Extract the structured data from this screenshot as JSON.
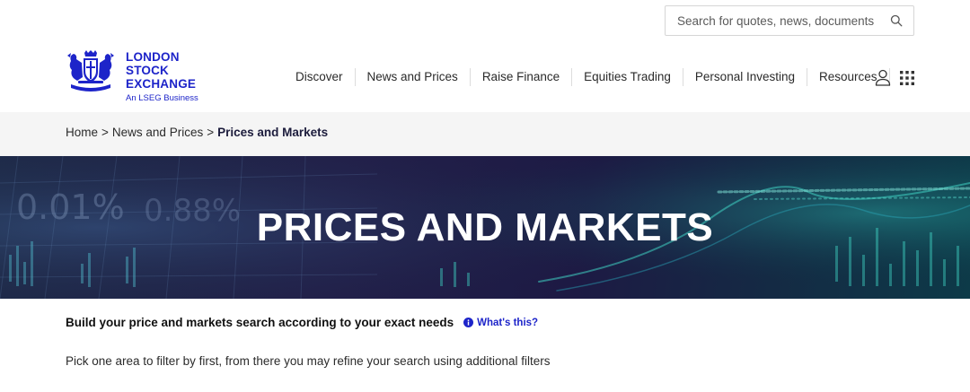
{
  "search": {
    "placeholder": "Search for quotes, news, documents",
    "icon": "search-icon"
  },
  "logo": {
    "line1": "LONDON",
    "line2": "STOCK",
    "line3": "EXCHANGE",
    "sub": "An LSEG Business",
    "color": "#1d24c9"
  },
  "nav": {
    "items": [
      {
        "label": "Discover"
      },
      {
        "label": "News and Prices"
      },
      {
        "label": "Raise Finance"
      },
      {
        "label": "Equities Trading"
      },
      {
        "label": "Personal Investing"
      },
      {
        "label": "Resources"
      }
    ],
    "user_icon": "user-icon",
    "apps_icon": "grid-icon"
  },
  "breadcrumb": {
    "home": "Home",
    "separator": ">",
    "parent": "News and Prices",
    "current": "Prices and Markets"
  },
  "hero": {
    "title": "PRICES AND MARKETS",
    "bg_text_1": "0.01%",
    "bg_text_2": "0.88%"
  },
  "intro": {
    "heading": "Build your price and markets search according to your exact needs",
    "whats_this": "What's this?",
    "body": "Pick one area to filter by first, from there you may refine your search using additional filters"
  },
  "colors": {
    "brand": "#1d24c9",
    "breadcrumb_bg": "#f5f5f5",
    "hero_bg": "#1e1c46"
  }
}
